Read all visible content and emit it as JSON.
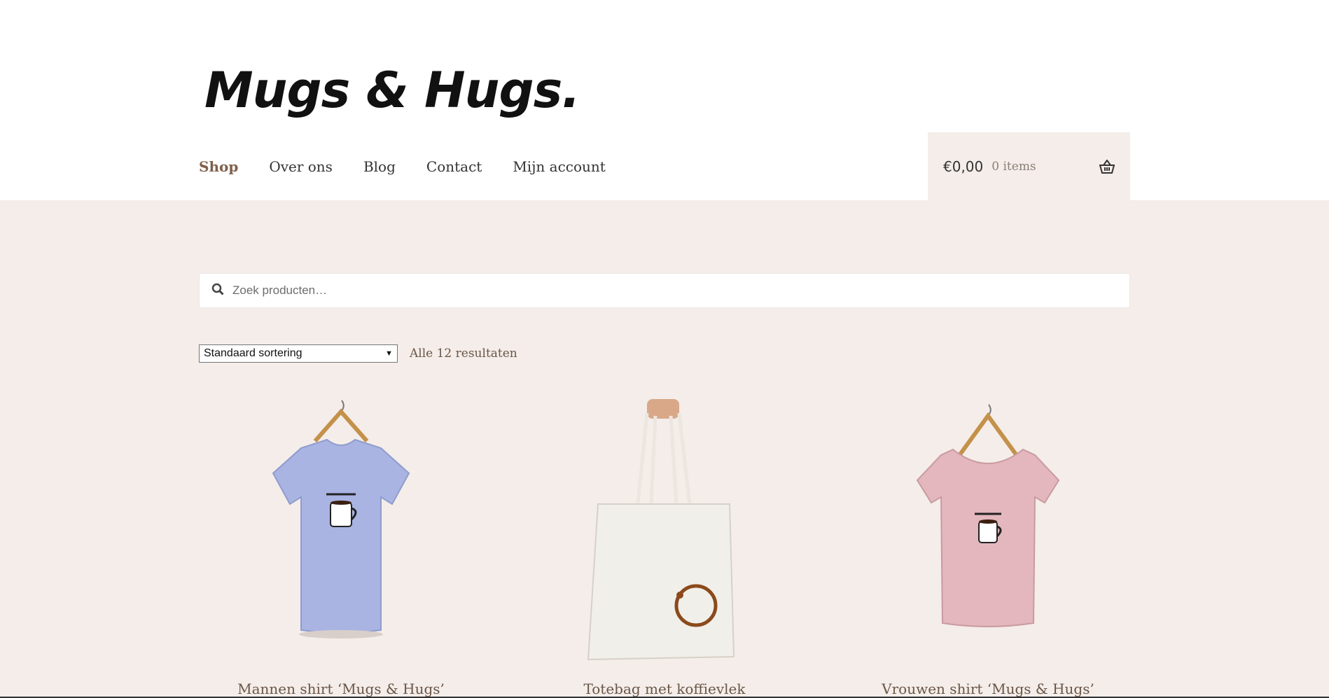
{
  "brand": {
    "name": "Mugs & Hugs."
  },
  "nav": {
    "items": [
      {
        "label": "Shop",
        "active": true
      },
      {
        "label": "Over ons"
      },
      {
        "label": "Blog"
      },
      {
        "label": "Contact"
      },
      {
        "label": "Mijn account"
      }
    ]
  },
  "cart": {
    "total": "€0,00",
    "count": "0 items",
    "icon": "basket-icon"
  },
  "search": {
    "placeholder": "Zoek producten…",
    "icon": "search-icon"
  },
  "sorting": {
    "selected": "Standaard sortering"
  },
  "results_text": "Alle 12 resultaten",
  "products": [
    {
      "title": "Mannen shirt ‘Mugs & Hugs’",
      "color": "#a9b4e3"
    },
    {
      "title": "Totebag met koffievlek",
      "color": "#f1efea"
    },
    {
      "title": "Vrouwen shirt ‘Mugs & Hugs’",
      "color": "#e3b7bd"
    }
  ],
  "colors": {
    "accent": "#7f5f4a",
    "background": "#f4ede9"
  }
}
